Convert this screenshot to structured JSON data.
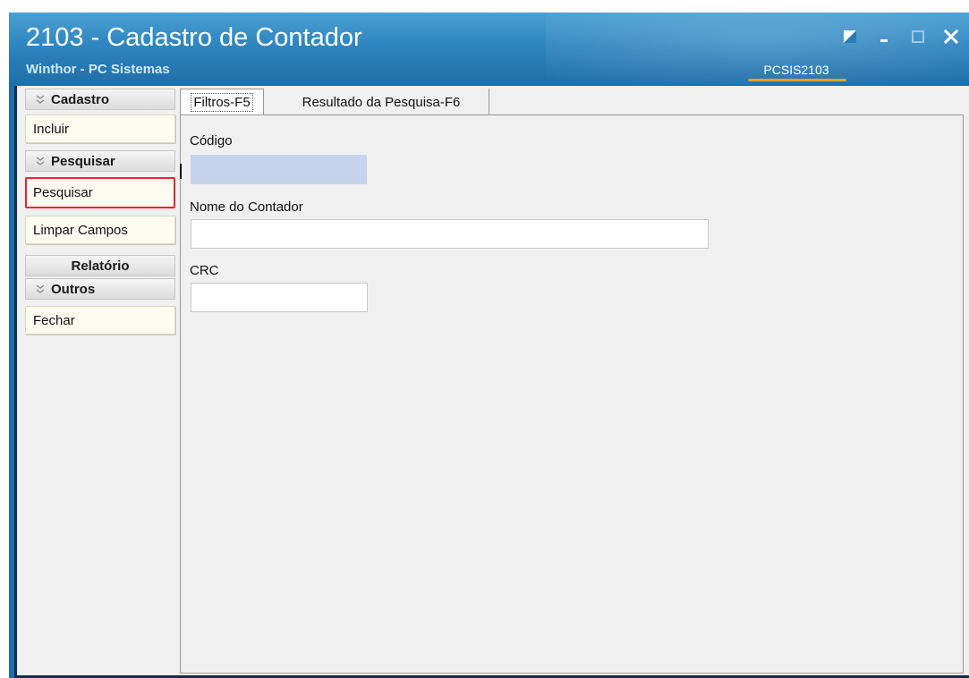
{
  "window": {
    "title": "2103 - Cadastro de Contador",
    "subtitle": "Winthor - PC Sistemas",
    "routine_code": "PCSIS2103"
  },
  "sidebar": {
    "sections": [
      {
        "header": "Cadastro",
        "items": [
          "Incluir"
        ]
      },
      {
        "header": "Pesquisar",
        "items": [
          "Pesquisar",
          "Limpar Campos"
        ]
      },
      {
        "header": "Relatório",
        "items": []
      },
      {
        "header": "Outros",
        "items": [
          "Fechar"
        ]
      }
    ],
    "highlighted_item": "Pesquisar"
  },
  "tabs": [
    {
      "label": "Filtros-F5",
      "active": true
    },
    {
      "label": "Resultado da Pesquisa-F6",
      "active": false
    }
  ],
  "filters": {
    "codigo": {
      "label": "Código",
      "value": ""
    },
    "nome": {
      "label": "Nome do Contador",
      "value": ""
    },
    "crc": {
      "label": "CRC",
      "value": ""
    }
  },
  "colors": {
    "titlebar": "#2f86c0",
    "highlight_border": "#e8282f",
    "active_input": "#c5d3ec",
    "routine_underline": "#e8a020"
  }
}
